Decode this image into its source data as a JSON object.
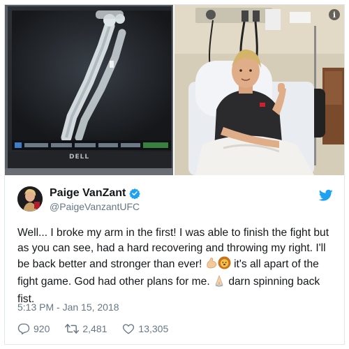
{
  "tweet": {
    "display_name": "Paige VanZant",
    "handle": "@PaigeVanzantUFC",
    "text_line1": "Well... I broke my arm in the first! I was able to finish the fight but",
    "text_line2": "as you can see, had a hard recovering and throwing my right. I'll",
    "text_line3a": "be back better and stronger than ever! ",
    "text_line3b": " it's all apart of the",
    "text_line4a": "fight game. God had other plans for me. ",
    "text_line4b": " darn spinning back",
    "text_line5": "fist.",
    "timestamp": "5:13 PM - Jan 15, 2018",
    "replies": "920",
    "retweets": "2,481",
    "likes": "13,305"
  },
  "media": {
    "monitor_brand": "DELL"
  },
  "icons": {
    "info": "info-icon",
    "verified": "verified-badge-icon",
    "bird": "twitter-bird-icon",
    "reply": "reply-icon",
    "retweet": "retweet-icon",
    "like": "heart-icon"
  },
  "colors": {
    "accent": "#1da1f2",
    "text": "#14171a",
    "muted": "#657786"
  }
}
